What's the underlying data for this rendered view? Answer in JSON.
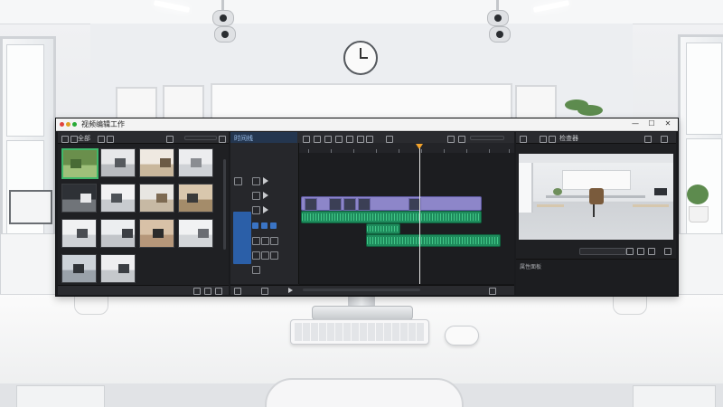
{
  "app": {
    "title": "视频编辑工作",
    "window_controls": [
      "—",
      "☐",
      "✕"
    ]
  },
  "media_browser": {
    "toolbar_label": "全部",
    "thumbs": [
      {
        "caption": "",
        "selected": true
      },
      {
        "caption": "",
        "selected": false
      },
      {
        "caption": "",
        "selected": false
      },
      {
        "caption": "",
        "selected": false
      },
      {
        "caption": "",
        "selected": false
      },
      {
        "caption": "",
        "selected": false
      },
      {
        "caption": "",
        "selected": false
      },
      {
        "caption": "",
        "selected": false
      },
      {
        "caption": "",
        "selected": false
      },
      {
        "caption": "",
        "selected": false
      },
      {
        "caption": "",
        "selected": false
      },
      {
        "caption": "",
        "selected": false
      },
      {
        "caption": "",
        "selected": false
      },
      {
        "caption": "",
        "selected": false
      }
    ]
  },
  "timeline": {
    "tab_label": "时间线",
    "colors": {
      "video": "#8d86c9",
      "audio": "#1e8b5c",
      "playhead": "#f3a32b",
      "selected": "#3fb86a",
      "track_active": "#2b5fa8"
    }
  },
  "viewer": {
    "tab_label": "检查器",
    "footer_label": "属性面板"
  },
  "icons": [
    "gear-icon",
    "search-icon",
    "play-icon",
    "scissors-icon",
    "zoom-icon",
    "plus-icon"
  ]
}
